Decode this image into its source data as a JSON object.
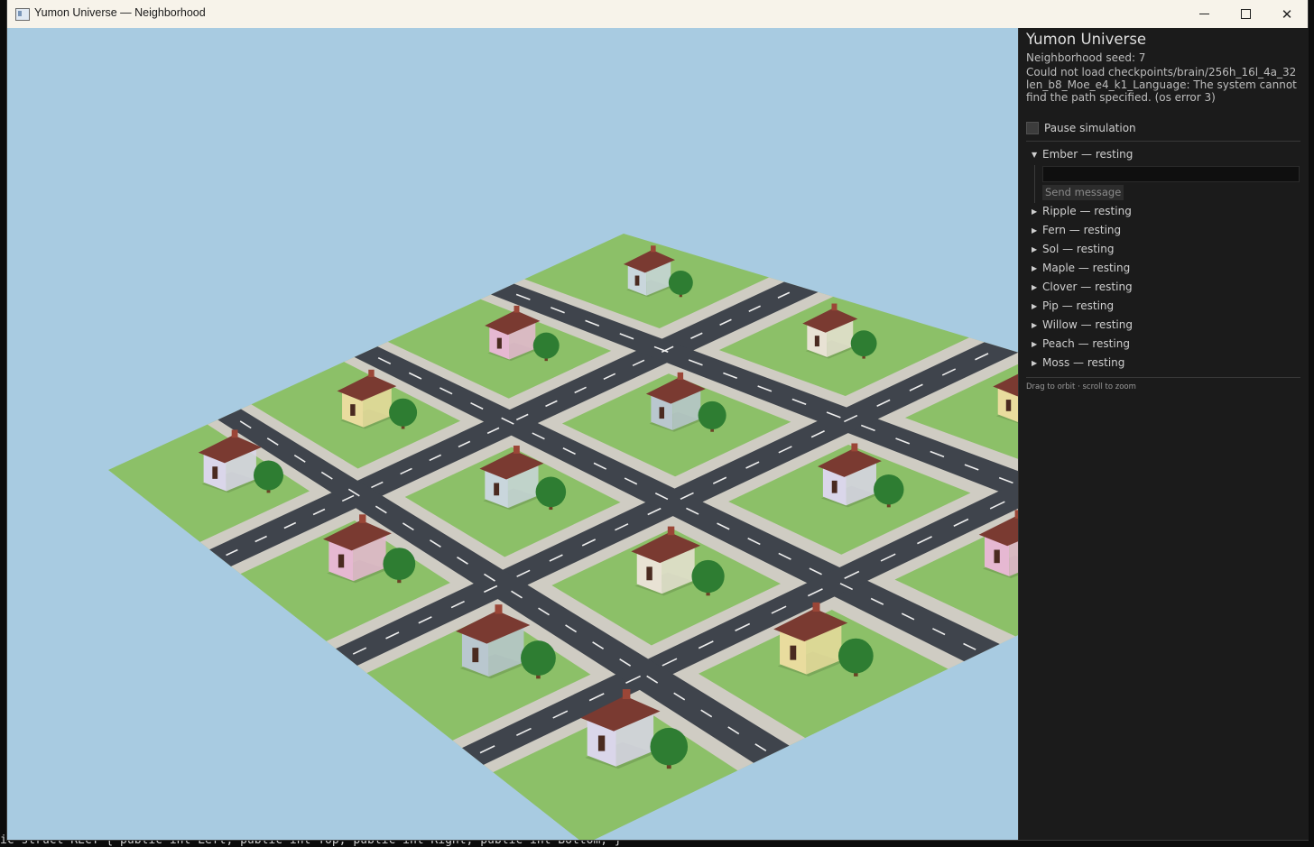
{
  "window": {
    "title": "Yumon Universe — Neighborhood"
  },
  "terminal": {
    "bottom_line": "ic struct RECT { public int Left; public int Top; public int Right; public int Bottom; }"
  },
  "panel": {
    "title": "Yumon Universe",
    "seed": "Neighborhood seed: 7",
    "error": "Could not load checkpoints/brain/256h_16l_4a_32len_b8_Moe_e4_k1_Language: The system cannot find the path specified. (os error 3)",
    "pause_label": "Pause simulation",
    "pause_checked": false,
    "message_value": "",
    "send_label": "Send message",
    "hint": "Drag to orbit · scroll to zoom",
    "yumons": [
      {
        "label": "Ember — resting",
        "expanded": true
      },
      {
        "label": "Ripple — resting",
        "expanded": false
      },
      {
        "label": "Fern — resting",
        "expanded": false
      },
      {
        "label": "Sol — resting",
        "expanded": false
      },
      {
        "label": "Maple — resting",
        "expanded": false
      },
      {
        "label": "Clover — resting",
        "expanded": false
      },
      {
        "label": "Pip — resting",
        "expanded": false
      },
      {
        "label": "Willow — resting",
        "expanded": false
      },
      {
        "label": "Peach — resting",
        "expanded": false
      },
      {
        "label": "Moss — resting",
        "expanded": false
      }
    ]
  },
  "colors": {
    "sky": "#a8cbe1",
    "grass": "#8cc068",
    "road": "#3f444c",
    "sidewalk": "#cfccc3",
    "roof": "#7a3a31",
    "tree": "#2e7d32",
    "panel_bg": "#1b1b1b"
  }
}
